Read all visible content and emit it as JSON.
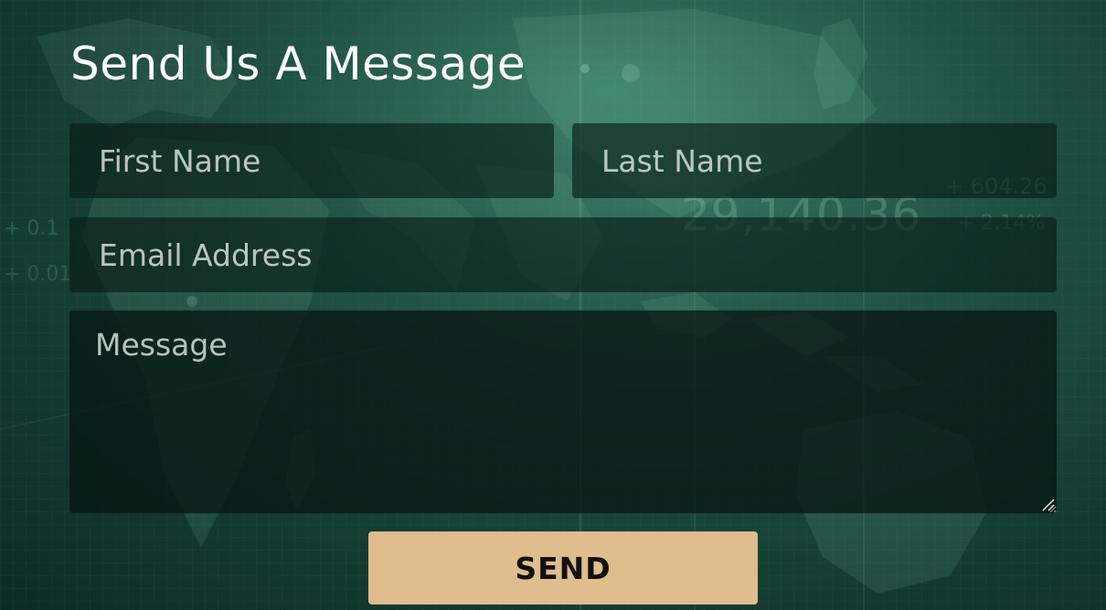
{
  "form": {
    "title": "Send Us A Message",
    "first_name": {
      "placeholder": "First Name",
      "value": ""
    },
    "last_name": {
      "placeholder": "Last Name",
      "value": ""
    },
    "email": {
      "placeholder": "Email Address",
      "value": ""
    },
    "message": {
      "placeholder": "Message",
      "value": ""
    },
    "send_label": "SEND"
  },
  "background": {
    "ticker_main": "29,140.36",
    "ticker_right_top": "+ 604.26",
    "ticker_right_bottom": "+ 2.14%",
    "ticker_left_top": "+ 0.1",
    "ticker_left_bottom": "+ 0.01"
  },
  "colors": {
    "background_base": "#1f5344",
    "field_fill": "#081a14",
    "button_fill": "#dfbd8d",
    "title_text": "#ffffff"
  }
}
